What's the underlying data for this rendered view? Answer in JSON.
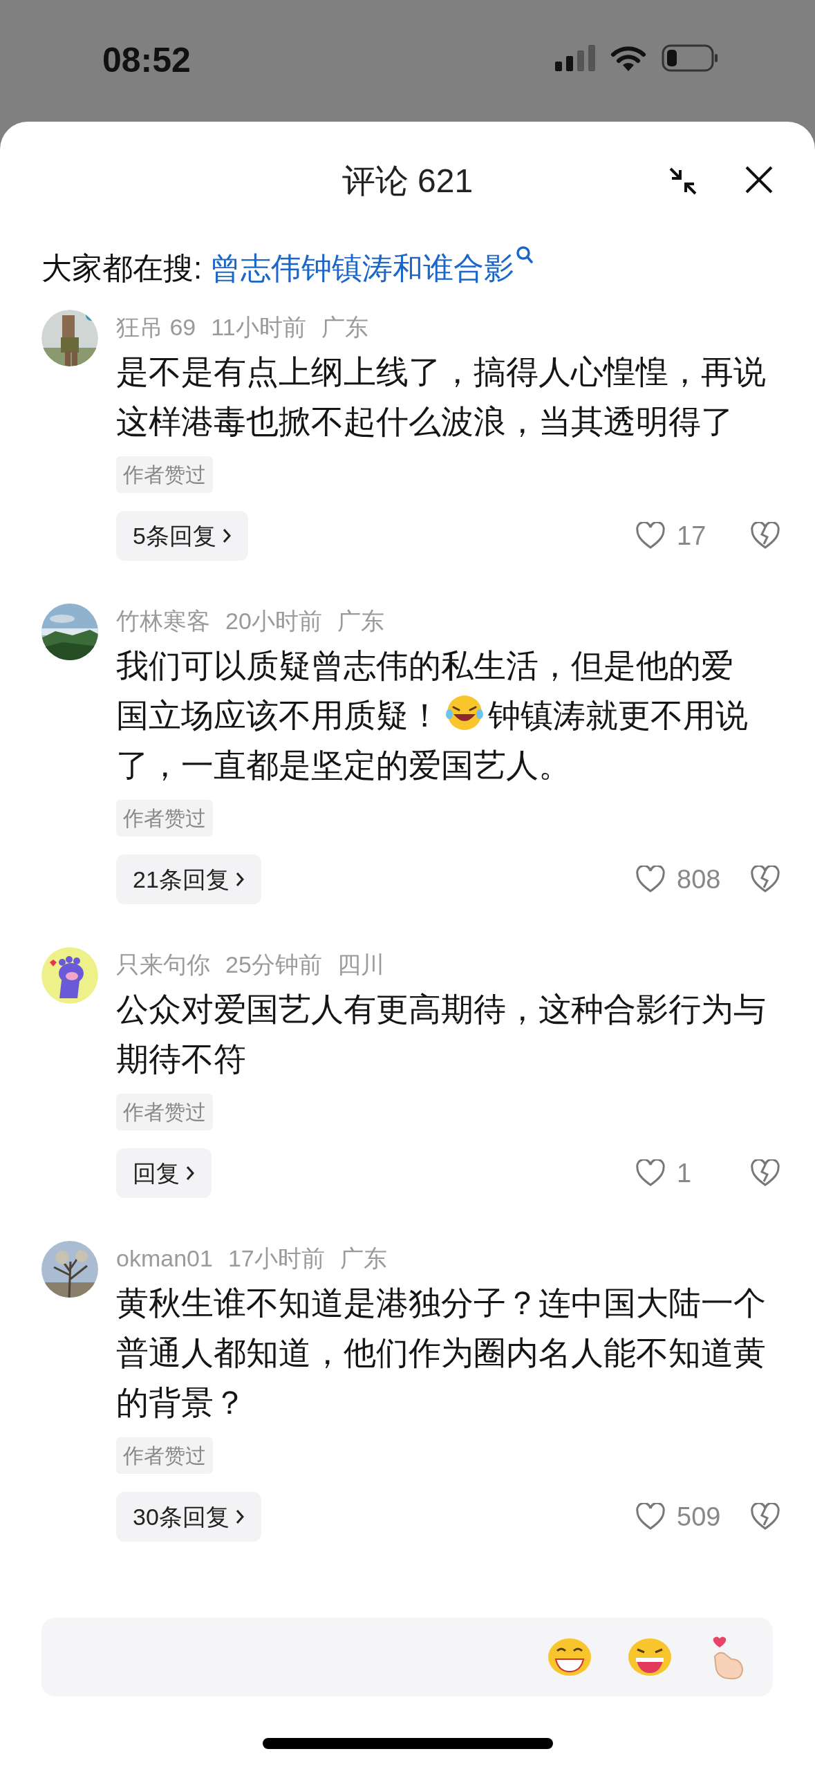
{
  "status_bar": {
    "time": "08:52"
  },
  "header": {
    "title": "评论 621"
  },
  "search": {
    "label": "大家都在搜:",
    "query": "曾志伟钟镇涛和谁合影"
  },
  "comments": [
    {
      "user": "狂吊 69",
      "time": "11小时前",
      "location": "广东",
      "content": [
        {
          "kind": "text",
          "text": "是不是有点上纲上线了，搞得人心惶惶，再说这样港毒也掀不起什么波浪，当其透明得了"
        }
      ],
      "badge": "作者赞过",
      "replies": "5条回复",
      "likes": "17"
    },
    {
      "user": "竹林寒客",
      "time": "20小时前",
      "location": "广东",
      "content": [
        {
          "kind": "text",
          "text": "我们可以质疑曾志伟的私生活，但是他的爱"
        },
        {
          "kind": "break"
        },
        {
          "kind": "text",
          "text": "国立场应该不用质疑！"
        },
        {
          "kind": "emoji"
        },
        {
          "kind": "text",
          "text": "钟镇涛就更不用说"
        },
        {
          "kind": "break"
        },
        {
          "kind": "text",
          "text": "了，一直都是坚定的爱国艺人。"
        }
      ],
      "badge": "作者赞过",
      "replies": "21条回复",
      "likes": "808"
    },
    {
      "user": "只来句你",
      "time": "25分钟前",
      "location": "四川",
      "content": [
        {
          "kind": "text",
          "text": "公众对爱国艺人有更高期待，这种合影行为与期待不符"
        }
      ],
      "badge": "作者赞过",
      "replies": "回复",
      "likes": "1"
    },
    {
      "user": "okman01",
      "time": "17小时前",
      "location": "广东",
      "content": [
        {
          "kind": "text",
          "text": "黄秋生谁不知道是港独分子？连中国大陆一个普通人都知道，他们作为圈内名人能不知道黄的背景？"
        }
      ],
      "badge": "作者赞过",
      "replies": "30条回复",
      "likes": "509"
    }
  ]
}
